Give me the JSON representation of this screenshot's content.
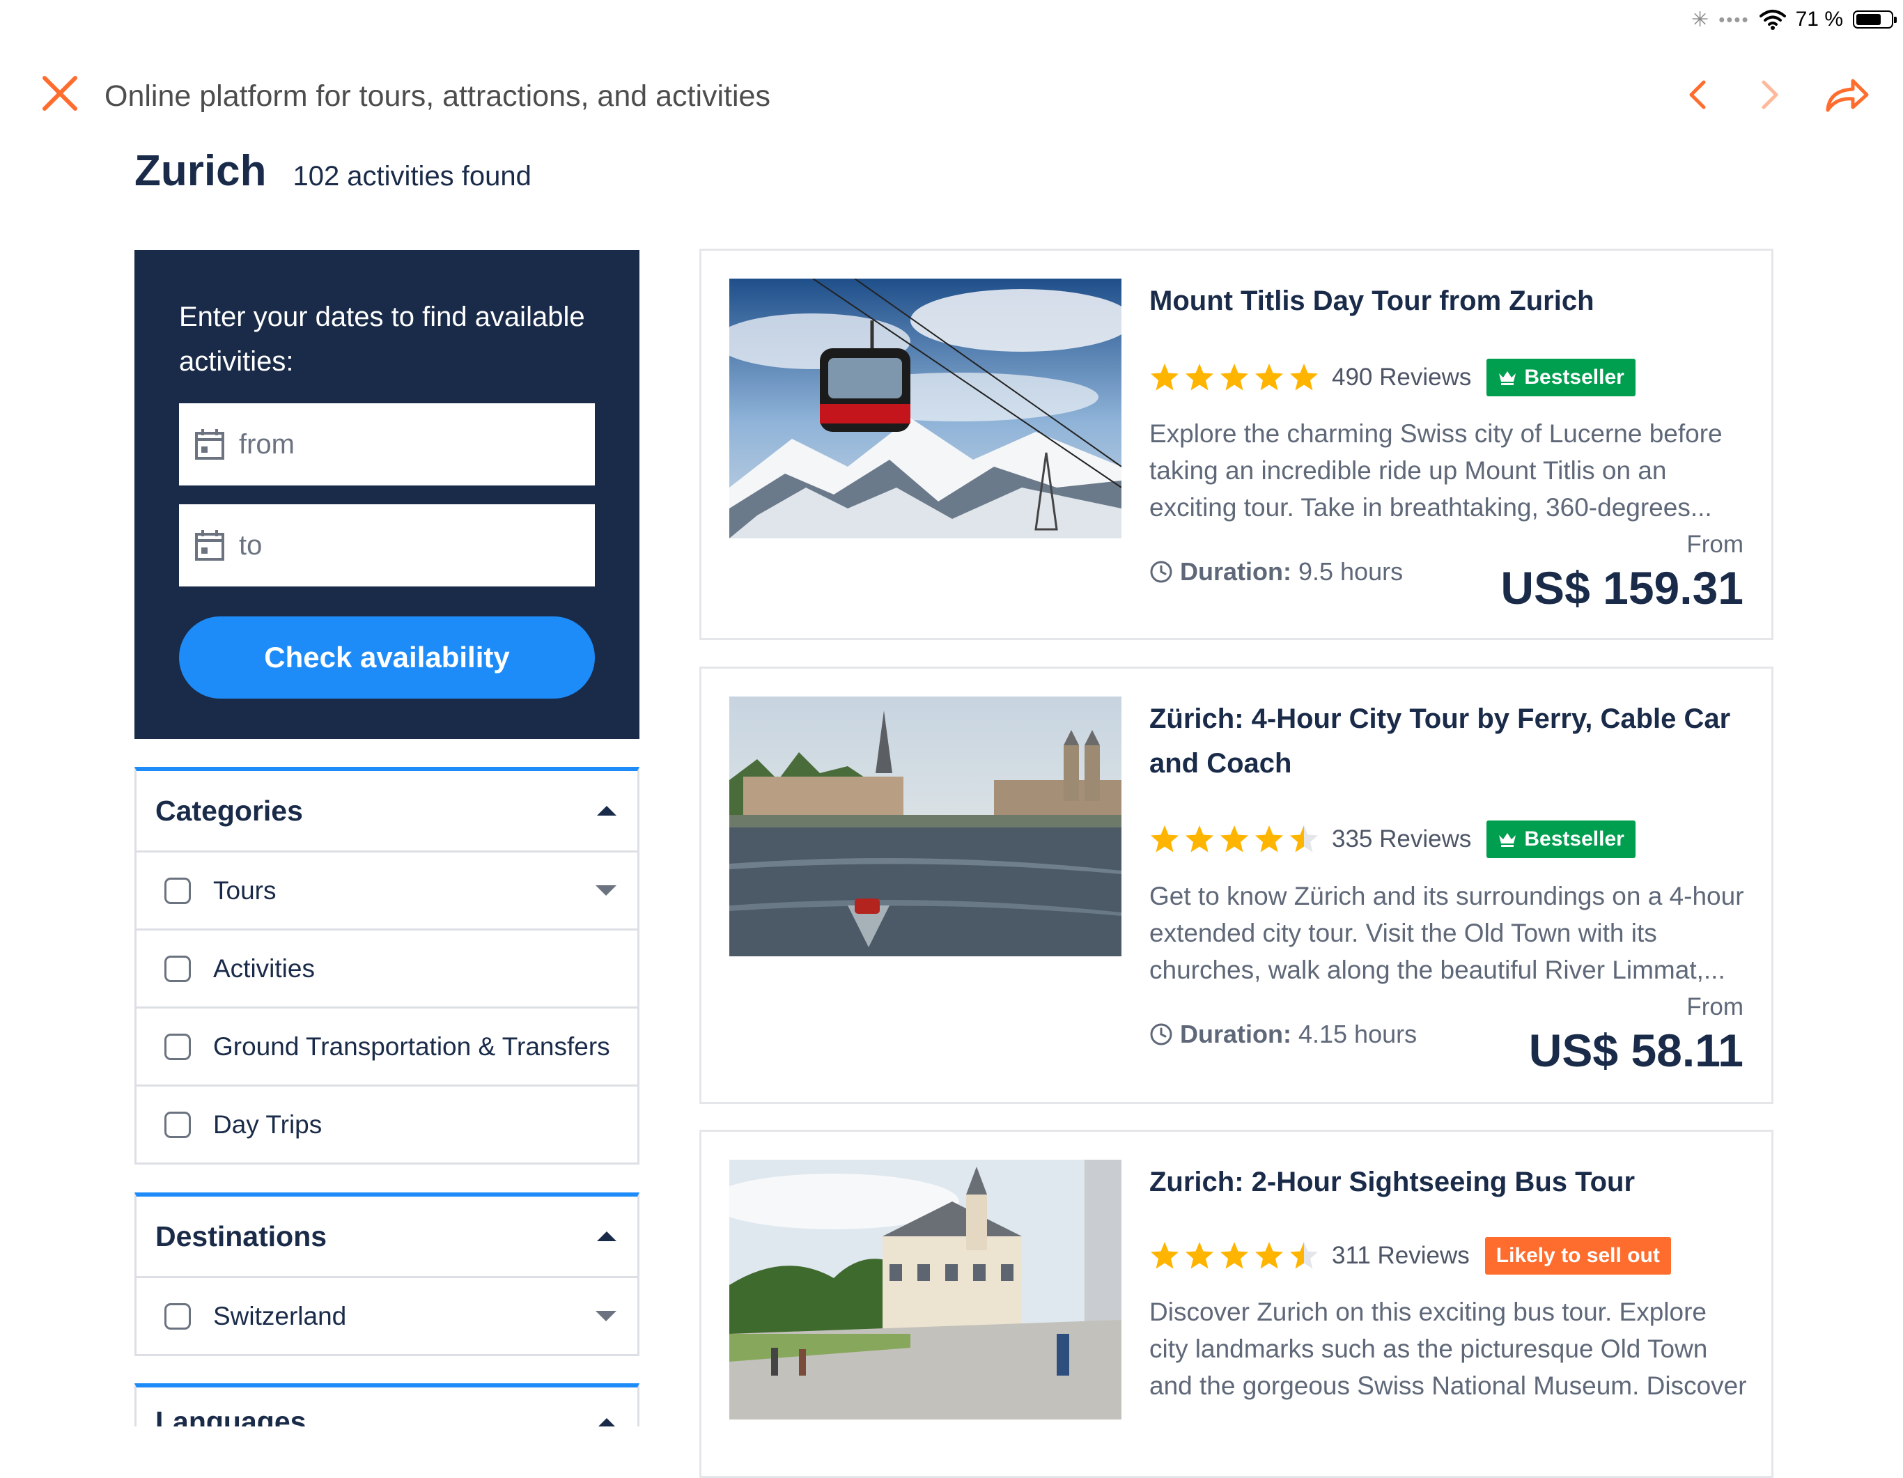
{
  "status_bar": {
    "battery": "71 %",
    "battery_level": 0.71
  },
  "nav": {
    "title": "Online platform for tours, attractions, and activities"
  },
  "heading": {
    "city": "Zurich",
    "count": "102 activities found"
  },
  "date_box": {
    "prompt": "Enter your dates to find available activities:",
    "from_placeholder": "from",
    "to_placeholder": "to",
    "check_label": "Check availability"
  },
  "categories": {
    "title": "Categories",
    "items": [
      {
        "label": "Tours"
      },
      {
        "label": "Activities"
      },
      {
        "label": "Ground Transportation & Transfers"
      },
      {
        "label": "Day Trips"
      }
    ]
  },
  "destinations": {
    "title": "Destinations",
    "items": [
      {
        "label": "Switzerland"
      }
    ]
  },
  "languages": {
    "title": "Languages"
  },
  "cards": [
    {
      "title": "Mount Titlis Day Tour from Zurich",
      "rating": 5,
      "reviews": "490 Reviews",
      "badge": "Bestseller",
      "description": "Explore the charming Swiss city of Lucerne before taking an incredible ride up Mount Titlis on an exciting tour. Take in breathtaking, 360-degrees...",
      "duration_label": "Duration:",
      "duration": "9.5 hours",
      "from": "From",
      "price": "US$ 159.31"
    },
    {
      "title": "Zürich: 4-Hour City Tour by Ferry, Cable Car and Coach",
      "rating": 4.5,
      "reviews": "335 Reviews",
      "badge": "Bestseller",
      "description": "Get to know Zürich and its surroundings on a 4-hour extended city tour. Visit the Old Town with its churches, walk along the beautiful River Limmat,...",
      "duration_label": "Duration:",
      "duration": "4.15 hours",
      "from": "From",
      "price": "US$ 58.11"
    },
    {
      "title": "Zurich: 2-Hour Sightseeing Bus Tour",
      "rating": 4.5,
      "reviews": "311 Reviews",
      "badge": "Likely to sell out",
      "description": "Discover Zurich on this exciting bus tour. Explore city landmarks such as the picturesque Old Town and the gorgeous Swiss National Museum. Discover"
    }
  ],
  "colors": {
    "accent": "#1d8cf8",
    "navy": "#1a2b49",
    "orange": "#ff6d2e",
    "green": "#009e4f",
    "star": "#ffb400"
  }
}
